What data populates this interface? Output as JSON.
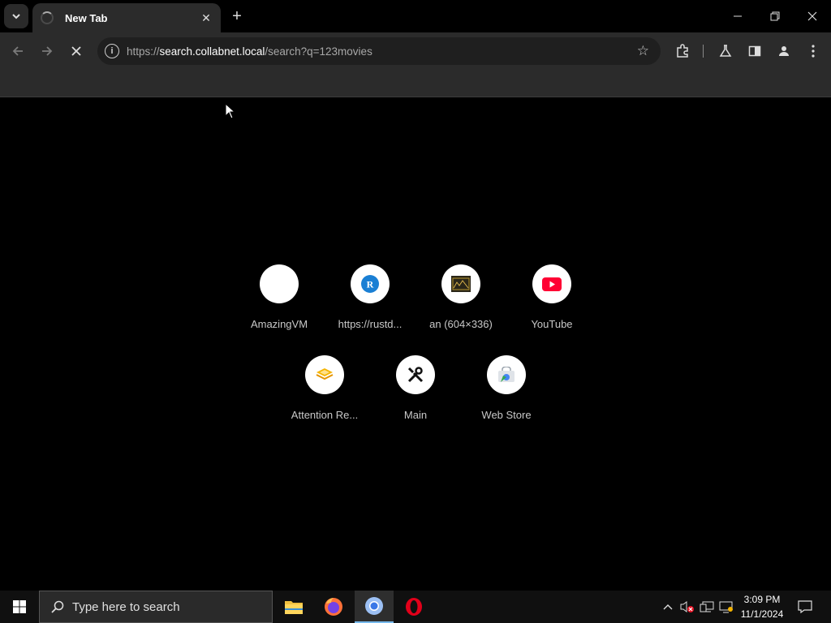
{
  "browser": {
    "tab": {
      "title": "New Tab"
    },
    "address": {
      "scheme": "https://",
      "host": "search.collabnet.local",
      "path": "/search?q=123movies"
    }
  },
  "shortcuts": [
    {
      "label": "AmazingVM",
      "icon": "blank-favicon"
    },
    {
      "label": "https://rustd...",
      "icon": "r-favicon",
      "color": "#1a7fd4"
    },
    {
      "label": "an (604×336)",
      "icon": "image-thumbnail"
    },
    {
      "label": "YouTube",
      "icon": "youtube-icon",
      "color": "#ff0033"
    },
    {
      "label": "Attention Re...",
      "icon": "layers-icon",
      "color": "#f5b400"
    },
    {
      "label": "Main",
      "icon": "tools-icon"
    },
    {
      "label": "Web Store",
      "icon": "web-store-icon",
      "color": "#4285f4"
    }
  ],
  "taskbar": {
    "search_placeholder": "Type here to search",
    "time": "3:09 PM",
    "date": "11/1/2024"
  }
}
